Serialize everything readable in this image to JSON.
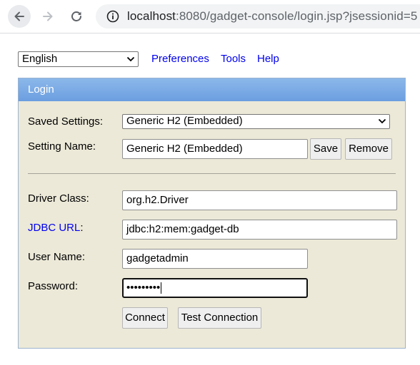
{
  "browser": {
    "url_host": "localhost",
    "url_path": ":8080/gadget-console/login.jsp?jsessionid=5"
  },
  "topbar": {
    "language": "English",
    "links": [
      "Preferences",
      "Tools",
      "Help"
    ]
  },
  "login": {
    "title": "Login",
    "saved_settings_label": "Saved Settings:",
    "saved_settings_value": "Generic H2 (Embedded)",
    "setting_name_label": "Setting Name:",
    "setting_name_value": "Generic H2 (Embedded)",
    "save_label": "Save",
    "remove_label": "Remove",
    "driver_class_label": "Driver Class:",
    "driver_class_value": "org.h2.Driver",
    "jdbc_url_label": "JDBC URL",
    "jdbc_url_colon": ":",
    "jdbc_url_value": "jdbc:h2:mem:gadget-db",
    "user_name_label": "User Name:",
    "user_name_value": "gadgetadmin",
    "password_label": "Password:",
    "password_value": "•••••••••",
    "connect_label": "Connect",
    "test_connection_label": "Test Connection"
  }
}
